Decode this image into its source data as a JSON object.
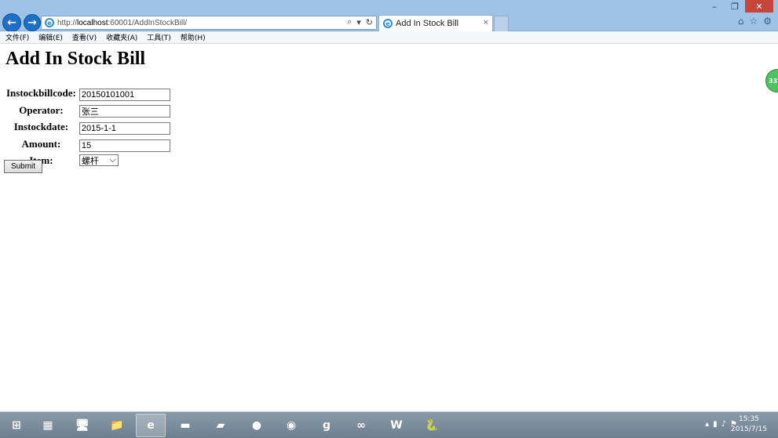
{
  "browser": {
    "url_prefix": "http://",
    "url_host": "localhost",
    "url_rest": ":60001/AddInStockBill/",
    "tab_title": "Add In Stock Bill",
    "tab_close": "×"
  },
  "menu": [
    "文件(F)",
    "编辑(E)",
    "查看(V)",
    "收藏夹(A)",
    "工具(T)",
    "帮助(H)"
  ],
  "page": {
    "heading": "Add In Stock Bill",
    "form": {
      "labels": [
        "Instockbillcode:",
        "Operator:",
        "Instockdate:",
        "Amount:",
        "Item:"
      ],
      "instockbillcode": "20150101001",
      "operator": "张三",
      "instockdate": "2015-1-1",
      "amount": "15",
      "item_selected": "螺杆"
    },
    "submit_label": "Submit",
    "side_badge": "33"
  },
  "taskbar": {
    "apps": [
      "windows-start-icon",
      "ship-app-icon",
      "computer-icon",
      "file-explorer-icon",
      "internet-explorer-icon",
      "command-prompt-icon",
      "notebook-icon",
      "paint-icon",
      "eclipse-icon",
      "chat-app-icon",
      "visual-studio-icon",
      "word-icon",
      "python-icon"
    ],
    "time": "15:35",
    "date": "2015/7/15"
  },
  "colors": {
    "chrome": "#9fc3e6",
    "close_button": "#c7463b",
    "taskbar": "#7a8b9a"
  }
}
